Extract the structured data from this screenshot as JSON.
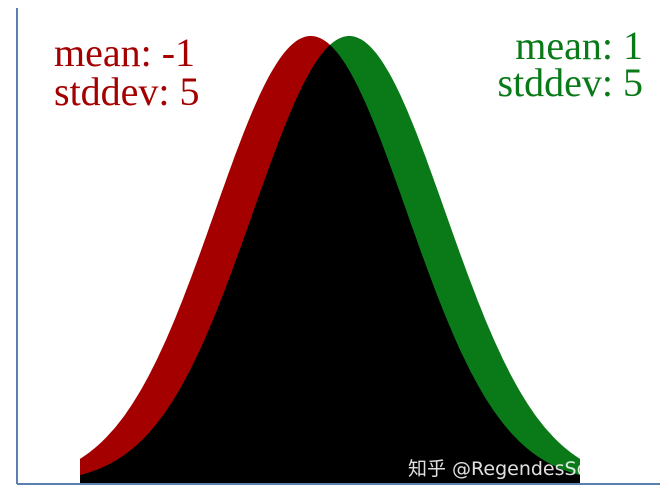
{
  "chart_data": {
    "type": "area",
    "title": "",
    "xlabel": "",
    "ylabel": "",
    "grid": false,
    "legend": "none",
    "xlim": [
      -13,
      13
    ],
    "series": [
      {
        "mean": -1,
        "stddev": 5,
        "label_lines": [
          "mean: -1",
          "stddev: 5"
        ],
        "color": "#a40000",
        "annotation_position": "top-left"
      },
      {
        "mean": 1,
        "stddev": 5,
        "label_lines": [
          "mean: 1",
          "stddev: 5"
        ],
        "color": "#0a7a19",
        "annotation_position": "top-right"
      }
    ],
    "overlap_color": "#000000",
    "axis_color": "#5b7fb0"
  },
  "watermark": "知乎 @RegendesSommers"
}
